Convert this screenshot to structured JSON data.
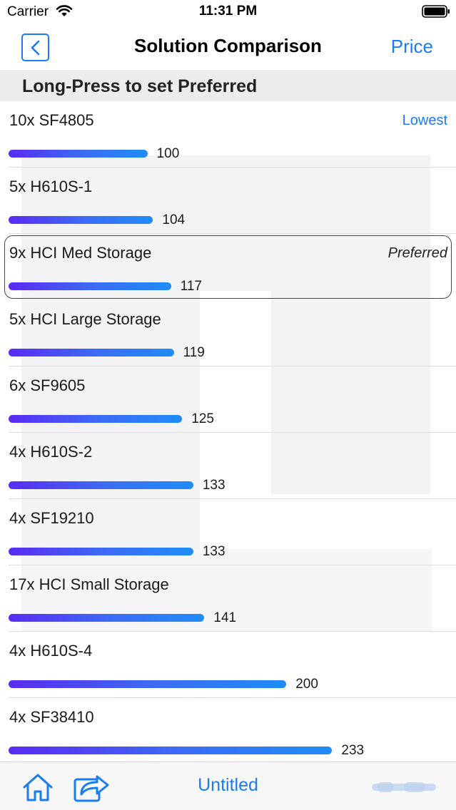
{
  "status_bar": {
    "carrier": "Carrier",
    "time": "11:31 PM"
  },
  "nav": {
    "title": "Solution Comparison",
    "price_label": "Price"
  },
  "section_header": "Long-Press to set Preferred",
  "colors": {
    "accent": "#1a7cf0",
    "bar_start": "#5b2bf3",
    "bar_end": "#1f8cf7"
  },
  "chart_data": {
    "type": "bar",
    "categories": [
      "10x SF4805",
      "5x H610S-1",
      "9x HCI Med Storage",
      "5x HCI Large Storage",
      "6x SF9605",
      "4x H610S-2",
      "4x SF19210",
      "17x HCI Small Storage",
      "4x H610S-4",
      "4x SF38410"
    ],
    "values": [
      100,
      104,
      117,
      119,
      125,
      133,
      133,
      141,
      200,
      233
    ]
  },
  "rows": [
    {
      "name": "10x SF4805",
      "value": "100",
      "badge": "Lowest",
      "badge_type": "lowest"
    },
    {
      "name": "5x H610S-1",
      "value": "104",
      "badge": "",
      "badge_type": ""
    },
    {
      "name": "9x HCI Med Storage",
      "value": "117",
      "badge": "Preferred",
      "badge_type": "preferred"
    },
    {
      "name": "5x HCI Large Storage",
      "value": "119",
      "badge": "",
      "badge_type": ""
    },
    {
      "name": "6x SF9605",
      "value": "125",
      "badge": "",
      "badge_type": ""
    },
    {
      "name": "4x H610S-2",
      "value": "133",
      "badge": "",
      "badge_type": ""
    },
    {
      "name": "4x SF19210",
      "value": "133",
      "badge": "",
      "badge_type": ""
    },
    {
      "name": "17x HCI Small Storage",
      "value": "141",
      "badge": "",
      "badge_type": ""
    },
    {
      "name": "4x H610S-4",
      "value": "200",
      "badge": "",
      "badge_type": ""
    },
    {
      "name": "4x SF38410",
      "value": "233",
      "badge": "",
      "badge_type": ""
    }
  ],
  "tab_bar": {
    "document_title": "Untitled"
  },
  "icons": {
    "back": "chevron-left-icon",
    "home": "home-icon",
    "share": "share-icon",
    "wifi": "wifi-icon",
    "battery": "battery-icon"
  }
}
